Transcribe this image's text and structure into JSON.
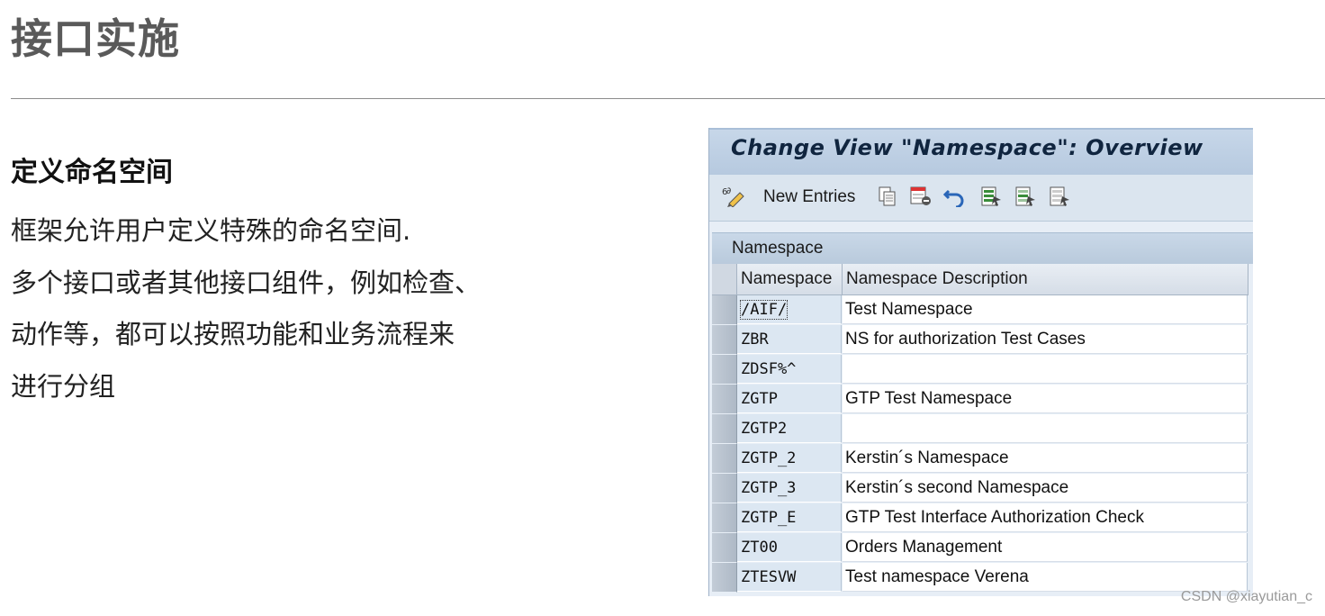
{
  "slide": {
    "title": "接口实施",
    "section_heading": "定义命名空间",
    "body_lines": [
      "框架允许用户定义特殊的命名空间.",
      "多个接口或者其他接口组件，例如检查、",
      "动作等，都可以按照功能和业务流程来",
      "进行分组"
    ]
  },
  "sap": {
    "window_title": "Change View \"Namespace\": Overview",
    "toolbar": {
      "new_entries_label": "New Entries",
      "icons": [
        "change-display-icon",
        "copy-icon",
        "delete-icon",
        "undo-icon",
        "select-all-icon",
        "select-block-icon",
        "deselect-all-icon"
      ]
    },
    "table": {
      "caption": "Namespace",
      "columns": [
        "Namespace",
        "Namespace Description"
      ],
      "rows": [
        {
          "namespace": "/AIF/",
          "description": "Test Namespace"
        },
        {
          "namespace": "ZBR",
          "description": "NS for authorization Test Cases"
        },
        {
          "namespace": "ZDSF%^",
          "description": ""
        },
        {
          "namespace": "ZGTP",
          "description": "GTP Test Namespace"
        },
        {
          "namespace": "ZGTP2",
          "description": ""
        },
        {
          "namespace": "ZGTP_2",
          "description": "Kerstin´s Namespace"
        },
        {
          "namespace": "ZGTP_3",
          "description": "Kerstin´s second Namespace"
        },
        {
          "namespace": "ZGTP_E",
          "description": "GTP Test Interface Authorization Check"
        },
        {
          "namespace": "ZT00",
          "description": "Orders Management"
        },
        {
          "namespace": "ZTESVW",
          "description": "Test namespace Verena"
        }
      ]
    }
  },
  "watermark": "CSDN @xiayutian_c",
  "colors": {
    "title_gray": "#5a5a5a",
    "sap_title_bar": "#b6c9df",
    "sap_header_text": "#10253f",
    "namespace_cell_bg": "#dce7f2"
  }
}
